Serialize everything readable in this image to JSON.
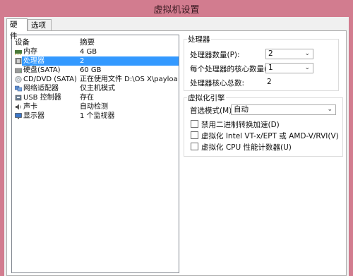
{
  "window": {
    "title": "虚拟机设置"
  },
  "tabs": [
    {
      "label": "硬件"
    },
    {
      "label": "选项"
    }
  ],
  "device_list": {
    "col_device": "设备",
    "col_summary": "摘要",
    "items": [
      {
        "name": "内存",
        "summary": "4 GB",
        "icon": "memory-icon"
      },
      {
        "name": "处理器",
        "summary": "2",
        "icon": "processor-icon"
      },
      {
        "name": "硬盘(SATA)",
        "summary": "60 GB",
        "icon": "harddisk-icon"
      },
      {
        "name": "CD/DVD (SATA)",
        "summary": "正在使用文件 D:\\OS X\\payload\\d...",
        "icon": "cd-dvd-icon"
      },
      {
        "name": "网络适配器",
        "summary": "仅主机模式",
        "icon": "network-adapter-icon"
      },
      {
        "name": "USB 控制器",
        "summary": "存在",
        "icon": "usb-icon"
      },
      {
        "name": "声卡",
        "summary": "自动检测",
        "icon": "sound-card-icon"
      },
      {
        "name": "显示器",
        "summary": "1 个监视器",
        "icon": "display-icon"
      }
    ],
    "selected_index": 1
  },
  "processor": {
    "group_title": "处理器",
    "count_label": "处理器数量(P):",
    "count_value": "2",
    "cores_label": "每个处理器的核心数量(C):",
    "cores_value": "1",
    "total_label": "处理器核心总数:",
    "total_value": "2"
  },
  "virtualization": {
    "group_title": "虚拟化引擎",
    "mode_label": "首选模式(M):",
    "mode_value": "自动",
    "options": [
      {
        "label": "禁用二进制转换加速(D)",
        "checked": false
      },
      {
        "label": "虚拟化 Intel VT-x/EPT 或 AMD-V/RVI(V)",
        "checked": false
      },
      {
        "label": "虚拟化 CPU 性能计数器(U)",
        "checked": false
      }
    ]
  },
  "colors": {
    "titlebar": "#d27c8f",
    "selection": "#3399ff"
  }
}
